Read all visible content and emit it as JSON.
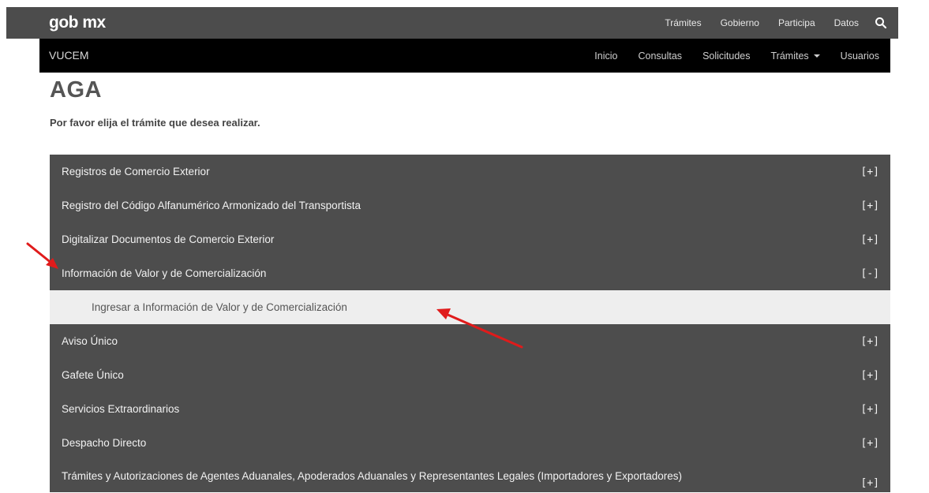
{
  "header": {
    "brand": "gob mx",
    "nav": [
      "Trámites",
      "Gobierno",
      "Participa",
      "Datos"
    ]
  },
  "subheader": {
    "brand": "VUCEM",
    "nav": [
      "Inicio",
      "Consultas",
      "Solicitudes",
      "Trámites",
      "Usuarios"
    ]
  },
  "page": {
    "title": "AGA",
    "instruction": "Por favor elija el trámite que desea realizar."
  },
  "menu": {
    "items": [
      {
        "label": "Registros de Comercio Exterior",
        "toggle": "[+]"
      },
      {
        "label": "Registro del Código Alfanumérico Armonizado del Transportista",
        "toggle": "[+]"
      },
      {
        "label": "Digitalizar Documentos de Comercio Exterior",
        "toggle": "[+]"
      },
      {
        "label": "Información de Valor y de Comercialización",
        "toggle": "[-]"
      },
      {
        "label": "Aviso Único",
        "toggle": "[+]"
      },
      {
        "label": "Gafete Único",
        "toggle": "[+]"
      },
      {
        "label": "Servicios Extraordinarios",
        "toggle": "[+]"
      },
      {
        "label": "Despacho Directo",
        "toggle": "[+]"
      },
      {
        "label": "Trámites y Autorizaciones de Agentes Aduanales, Apoderados Aduanales y Representantes Legales (Importadores y Exportadores)",
        "toggle": "[+]"
      }
    ],
    "subitem": {
      "label": "Ingresar a Información de Valor y de Comercialización"
    }
  },
  "colors": {
    "topbar": "#4c4c4c",
    "subbar": "#000000",
    "menu_bg": "#4d4d4d",
    "subitem_bg": "#eeeeee",
    "annotation_arrow": "#e01b1b"
  },
  "icons": [
    "search-icon",
    "chevron-down-icon",
    "red-arrow-annotation"
  ]
}
